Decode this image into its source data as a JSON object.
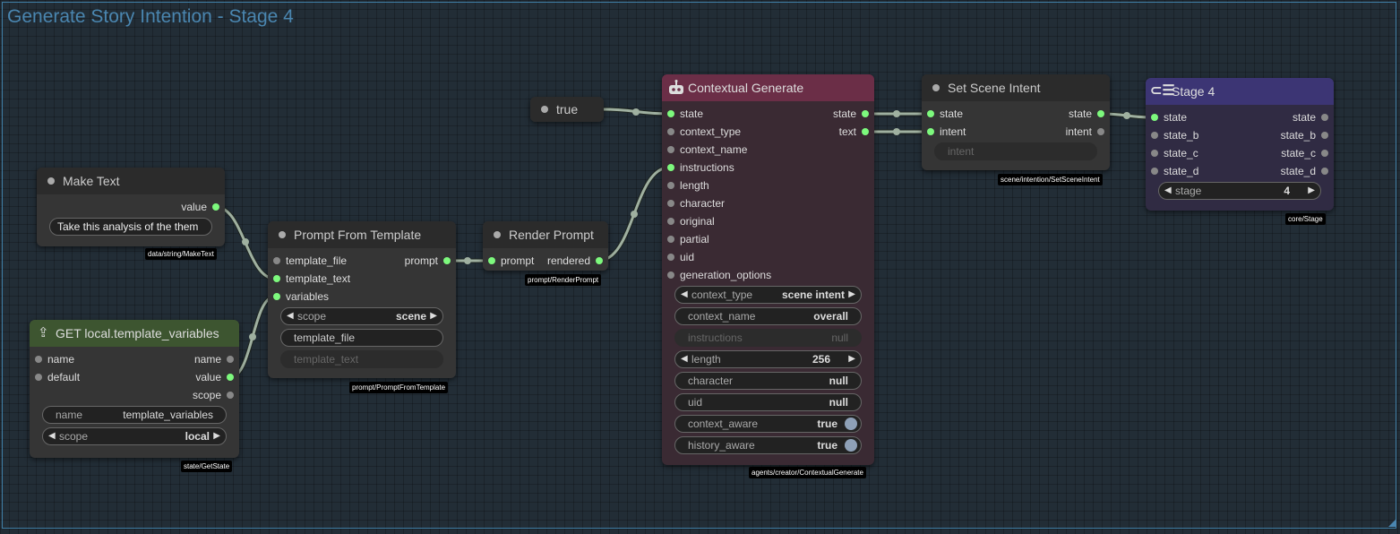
{
  "canvas": {
    "group_title": "Generate Story Intention - Stage 4"
  },
  "nodes": {
    "make_text": {
      "title": "Make Text",
      "outputs": [
        "value"
      ],
      "widget_value": "Take this analysis of the them",
      "badge": "data/string/MakeText"
    },
    "get_state": {
      "title": "GET local.template_variables",
      "inputs": [
        "name",
        "default"
      ],
      "outputs": [
        "name",
        "value",
        "scope"
      ],
      "widgets": {
        "name": {
          "label": "name",
          "value": "template_variables"
        },
        "scope": {
          "label": "scope",
          "value": "local"
        }
      },
      "badge": "state/GetState"
    },
    "prompt_from_template": {
      "title": "Prompt From Template",
      "inputs": [
        "template_file",
        "template_text",
        "variables"
      ],
      "outputs": [
        "prompt"
      ],
      "widgets": {
        "scope": {
          "label": "scope",
          "value": "scene"
        },
        "template_file": {
          "label": "template_file"
        },
        "template_text": {
          "label": "template_text"
        }
      },
      "badge": "prompt/PromptFromTemplate"
    },
    "render_prompt": {
      "title": "Render Prompt",
      "inputs": [
        "prompt"
      ],
      "outputs": [
        "rendered"
      ],
      "badge": "prompt/RenderPrompt"
    },
    "true_node": {
      "title": "true"
    },
    "contextual_generate": {
      "title": "Contextual Generate",
      "icon": "robot-icon",
      "color": "#6b2e47",
      "inputs": [
        "state",
        "context_type",
        "context_name",
        "instructions",
        "length",
        "character",
        "original",
        "partial",
        "uid",
        "generation_options"
      ],
      "outputs": [
        "state",
        "text"
      ],
      "widgets": [
        {
          "label": "context_type",
          "value": "scene intent"
        },
        {
          "label": "context_name",
          "value": "overall"
        },
        {
          "label": "instructions",
          "value": "null"
        },
        {
          "label": "length",
          "value": "256"
        },
        {
          "label": "character",
          "value": "null"
        },
        {
          "label": "uid",
          "value": "null"
        },
        {
          "label": "context_aware",
          "value": "true"
        },
        {
          "label": "history_aware",
          "value": "true"
        }
      ],
      "badge": "agents/creator/ContextualGenerate"
    },
    "set_scene_intent": {
      "title": "Set Scene Intent",
      "inputs": [
        "state",
        "intent"
      ],
      "outputs": [
        "state",
        "intent"
      ],
      "widget_label": "intent",
      "badge": "scene/intention/SetSceneIntent"
    },
    "stage": {
      "title": "Stage 4",
      "icon": "stage-icon",
      "color": "#3c3574",
      "inputs": [
        "state",
        "state_b",
        "state_c",
        "state_d"
      ],
      "outputs": [
        "state",
        "state_b",
        "state_c",
        "state_d"
      ],
      "widget": {
        "label": "stage",
        "value": "4"
      },
      "badge": "core/Stage"
    }
  },
  "colors": {
    "link": "#9fb0a0",
    "connected_slot": "#7df97d",
    "group_frame": "#3f7ca3"
  }
}
